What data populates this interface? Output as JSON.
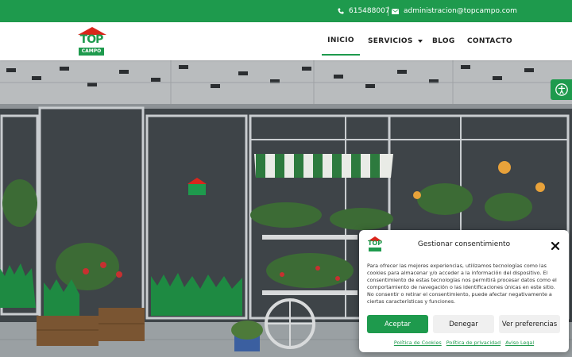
{
  "topbar": {
    "phone": "615488007",
    "email": "administracion@topcampo.com",
    "phone_icon": "phone-icon",
    "email_icon": "mail-icon"
  },
  "logo": {
    "line1": "TOP",
    "line2": "CAMPO"
  },
  "nav": {
    "items": [
      {
        "label": "INICIO",
        "active": true
      },
      {
        "label": "SERVICIOS",
        "has_dropdown": true
      },
      {
        "label": "BLOG"
      },
      {
        "label": "CONTACTO"
      }
    ]
  },
  "accessibility": {
    "icon": "accessibility-icon"
  },
  "consent": {
    "title": "Gestionar consentimiento",
    "body": "Para ofrecer las mejores experiencias, utilizamos tecnologías como las cookies para almacenar y/o acceder a la información del dispositivo. El consentimiento de estas tecnologías nos permitirá procesar datos como el comportamiento de navegación o las identificaciones únicas en este sitio. No consentir o retirar el consentimiento, puede afectar negativamente a ciertas características y funciones.",
    "accept": "Aceptar",
    "deny": "Denegar",
    "preferences": "Ver preferencias",
    "links": [
      "Política de Cookies",
      "Política de privacidad",
      "Aviso Legal"
    ]
  },
  "colors": {
    "brand_green": "#1e9a4d",
    "brand_red": "#d9261c"
  }
}
